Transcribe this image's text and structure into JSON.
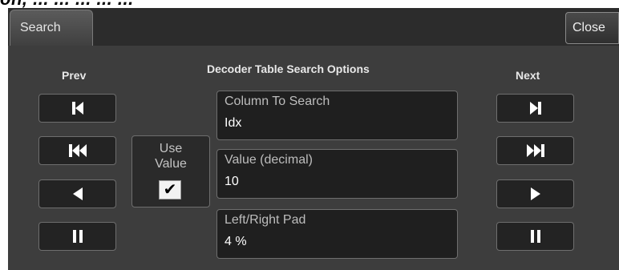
{
  "page_header": "on, ... ... ... ... ...",
  "tab": {
    "label": "Search"
  },
  "close": {
    "label": "Close"
  },
  "panel_title": "Decoder Table Search Options",
  "prev": {
    "title": "Prev",
    "buttons": [
      {
        "icon": "skip-to-first-icon"
      },
      {
        "icon": "fast-rewind-icon"
      },
      {
        "icon": "step-back-icon"
      },
      {
        "icon": "pause-icon"
      }
    ]
  },
  "next": {
    "title": "Next",
    "buttons": [
      {
        "icon": "skip-to-last-icon"
      },
      {
        "icon": "fast-forward-icon"
      },
      {
        "icon": "play-icon"
      },
      {
        "icon": "pause-icon"
      }
    ]
  },
  "use_value": {
    "label": "Use\nValue",
    "checked": true,
    "check_glyph": "✔"
  },
  "fields": {
    "column": {
      "label": "Column To Search",
      "value": "Idx"
    },
    "value": {
      "label": "Value (decimal)",
      "value": "10"
    },
    "pad": {
      "label": "Left/Right Pad",
      "value": "4 %"
    }
  },
  "colors": {
    "panel_bg": "#3d3d3d",
    "field_bg": "#1f1f1f",
    "button_bg": "#232323",
    "icon": "#ffffff"
  }
}
